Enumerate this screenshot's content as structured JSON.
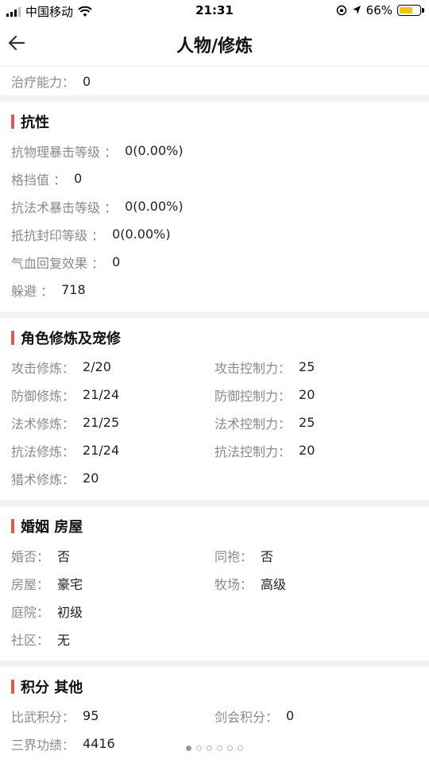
{
  "status_bar": {
    "carrier": "中国移动",
    "time": "21:31",
    "battery_percent": "66%",
    "battery_level": 0.66,
    "battery_color": "#f5c400"
  },
  "nav": {
    "title": "人物/修炼",
    "back_icon": "arrow-left-icon"
  },
  "top_row": {
    "label": "治疗能力：",
    "value": "0"
  },
  "accent_color": "#e05a5a",
  "resistance": {
    "title": "抗性",
    "items": [
      {
        "label": "抗物理暴击等级 ：",
        "value": "0(0.00%)"
      },
      {
        "label": "格挡值 ：",
        "value": "0"
      },
      {
        "label": "抗法术暴击等级 ：",
        "value": "0(0.00%)"
      },
      {
        "label": "抵抗封印等级 ：",
        "value": "0(0.00%)"
      },
      {
        "label": "气血回复效果 ：",
        "value": "0"
      },
      {
        "label": "躲避 ：",
        "value": "718"
      }
    ]
  },
  "cultivation": {
    "title": "角色修炼及宠修",
    "items": [
      {
        "label": "攻击修炼：",
        "value": "2/20"
      },
      {
        "label": "攻击控制力：",
        "value": "25"
      },
      {
        "label": "防御修炼：",
        "value": "21/24"
      },
      {
        "label": "防御控制力：",
        "value": "20"
      },
      {
        "label": "法术修炼：",
        "value": "21/25"
      },
      {
        "label": "法术控制力：",
        "value": "25"
      },
      {
        "label": "抗法修炼：",
        "value": "21/24"
      },
      {
        "label": "抗法控制力：",
        "value": "20"
      },
      {
        "label": "猎术修炼：",
        "value": "20"
      }
    ]
  },
  "marriage": {
    "title": "婚姻 房屋",
    "items": [
      {
        "label": "婚否：",
        "value": "否"
      },
      {
        "label": "同袍：",
        "value": "否"
      },
      {
        "label": "房屋：",
        "value": "豪宅"
      },
      {
        "label": "牧场：",
        "value": "高级"
      },
      {
        "label": "庭院：",
        "value": "初级"
      },
      {
        "label": "社区：",
        "value": "无"
      }
    ]
  },
  "points": {
    "title": "积分 其他",
    "items": [
      {
        "label": "比武积分：",
        "value": "95"
      },
      {
        "label": "剑会积分：",
        "value": "0"
      },
      {
        "label": "三界功绩：",
        "value": "4416"
      }
    ]
  },
  "pager": {
    "count": 6,
    "active_index": 0
  }
}
